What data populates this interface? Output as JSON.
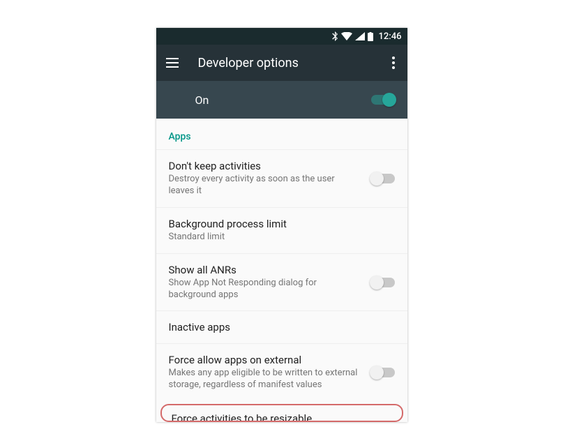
{
  "status": {
    "time": "12:46"
  },
  "appbar": {
    "title": "Developer options"
  },
  "master": {
    "label": "On"
  },
  "section": {
    "apps": "Apps"
  },
  "items": {
    "dont_keep": {
      "title": "Don't keep activities",
      "sub": "Destroy every activity as soon as the user leaves it"
    },
    "bg_limit": {
      "title": "Background process limit",
      "sub": "Standard limit"
    },
    "anrs": {
      "title": "Show all ANRs",
      "sub": "Show App Not Responding dialog for background apps"
    },
    "inactive": {
      "title": "Inactive apps"
    },
    "force_ext": {
      "title": "Force allow apps on external",
      "sub": "Makes any app eligible to be written to external storage, regardless of manifest values"
    },
    "force_resize": {
      "title": "Force activities to be resizable"
    }
  }
}
